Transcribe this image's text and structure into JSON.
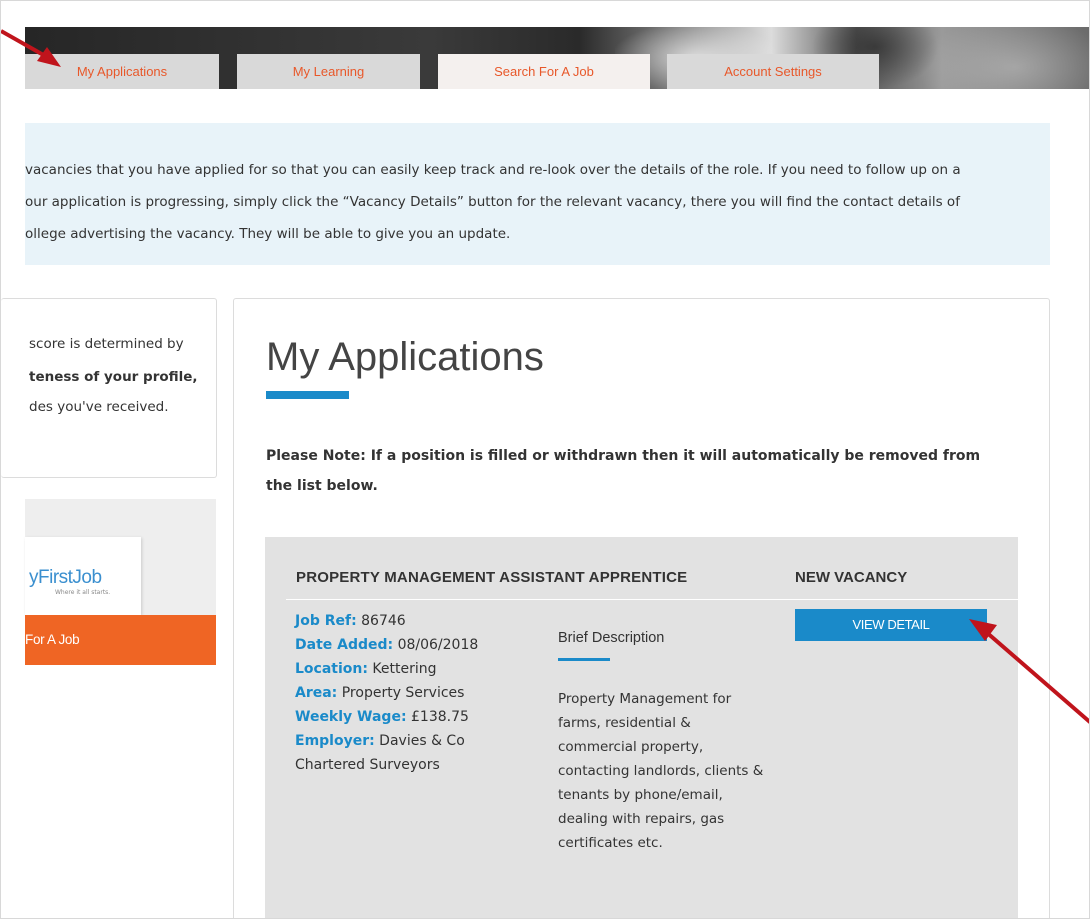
{
  "nav": {
    "tabs": [
      {
        "label": "My Applications"
      },
      {
        "label": "My Learning"
      },
      {
        "label": "Search For A Job"
      },
      {
        "label": "Account Settings"
      }
    ]
  },
  "info": {
    "lines": [
      "vacancies that you have applied for so that you can easily keep track and re-look over the details of the role. If you need to follow up on a",
      "our application is progressing, simply click the “Vacancy Details” button for the relevant vacancy, there you will find the contact details of",
      "ollege advertising the vacancy. They will be able to give you an update."
    ]
  },
  "score_card": {
    "line1": "score is determined by",
    "line2": "teness of your profile,",
    "line3": "des you've received."
  },
  "promo": {
    "logo": "yFirstJob",
    "tagline": "Where it all starts.",
    "button": "For A Job"
  },
  "main": {
    "title": "My Applications",
    "note": "Please Note: If a position is filled or withdrawn then it will automatically be removed from the list below."
  },
  "application": {
    "title": "PROPERTY MANAGEMENT ASSISTANT APPRENTICE",
    "status": "NEW VACANCY",
    "view_button": "VIEW DETAIL",
    "fields": {
      "job_ref_label": "Job Ref:",
      "job_ref": "86746",
      "date_label": "Date Added:",
      "date": "08/06/2018",
      "location_label": "Location:",
      "location": "Kettering",
      "area_label": "Area:",
      "area": "Property Services",
      "wage_label": "Weekly Wage:",
      "wage": "£138.75",
      "employer_label": "Employer:",
      "employer": "Davies & Co",
      "employer_line2": "Chartered Surveyors"
    },
    "brief_heading": "Brief Description",
    "brief_lines": [
      "Property Management for",
      "farms, residential &",
      "commercial property,",
      "contacting landlords, clients &",
      "tenants by phone/email,",
      "dealing with repairs, gas",
      "certificates etc."
    ]
  },
  "colors": {
    "accent_blue": "#1a8ac9",
    "accent_orange": "#ef6524",
    "tab_text": "#e8582a",
    "annotation_arrow": "#c0141c"
  }
}
